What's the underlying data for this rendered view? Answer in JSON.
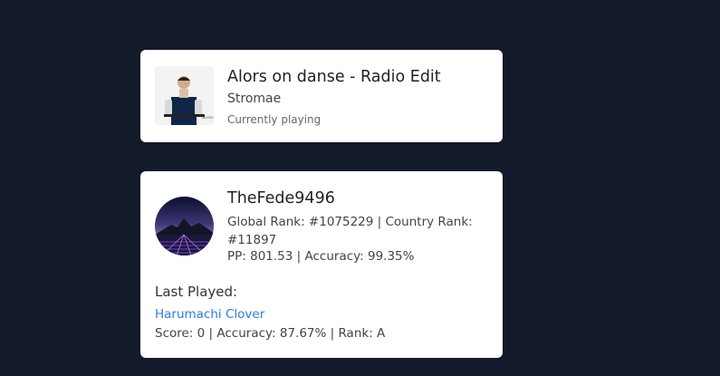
{
  "now_playing": {
    "title": "Alors on danse - Radio Edit",
    "artist": "Stromae",
    "status": "Currently playing",
    "art_icon": "album-art-image"
  },
  "profile": {
    "username": "TheFede9496",
    "ranks": "Global Rank: #1075229 | Country Rank: #11897",
    "pp": "PP: 801.53 | Accuracy: 99.35%",
    "avatar_icon": "avatar-image",
    "last_played": {
      "label": "Last Played:",
      "song": "Harumachi Clover",
      "stats": "Score: 0 | Accuracy: 87.67% | Rank: A"
    }
  },
  "colors": {
    "background": "#131a2a",
    "card": "#ffffff",
    "link": "#2f7cd8"
  }
}
